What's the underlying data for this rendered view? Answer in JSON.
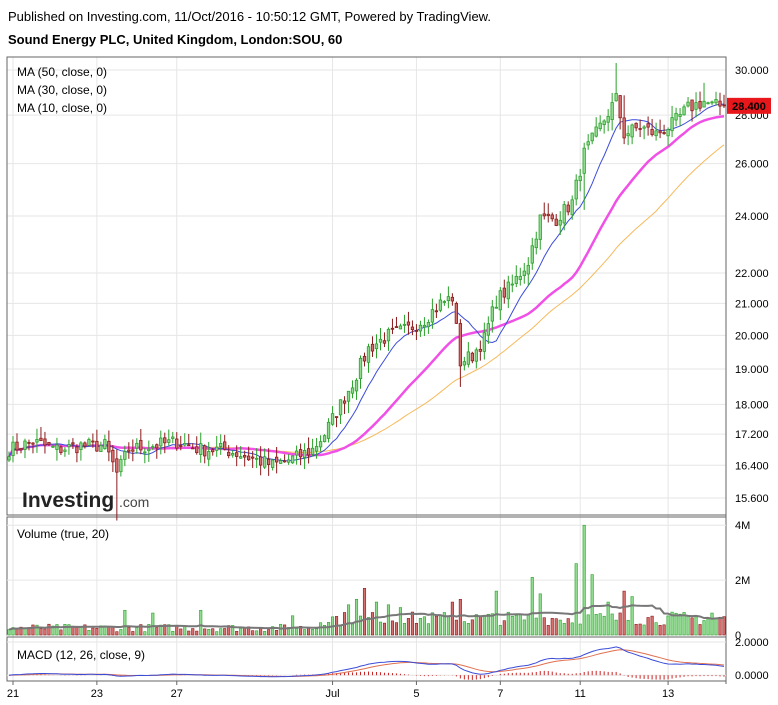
{
  "header": {
    "published": "Published on Investing.com, 11/Oct/2016 - 10:50:12 GMT, Powered by TradingView.",
    "instrument": "Sound Energy PLC, United Kingdom, London:SOU, 60"
  },
  "brand": {
    "logo_text": "Investing",
    "logo_suffix": ".com"
  },
  "colors": {
    "up": "#2aa22a",
    "up_fill": "#8fdc8f",
    "down": "#8b1a1a",
    "down_fill": "#d97070",
    "ma10": "#3b4cd8",
    "ma30": "#f050e6",
    "ma50": "#f6b95a",
    "vol_ma": "#777777",
    "macd": "#3b4cd8",
    "signal": "#e07050",
    "hist": "#cc2222",
    "price_tag": "#e8171b"
  },
  "chart_data": [
    {
      "type": "candlestick",
      "title": "Sound Energy PLC, United Kingdom, London:SOU, 60",
      "indicators": [
        "MA (50, close, 0)",
        "MA (30, close, 0)",
        "MA (10, close, 0)"
      ],
      "ylim": [
        15.2,
        30.6
      ],
      "y_scale": "log",
      "y_ticks": [
        "30.000",
        "28.000",
        "26.000",
        "24.000",
        "22.000",
        "21.000",
        "20.000",
        "19.000",
        "18.000",
        "17.200",
        "16.400",
        "15.600"
      ],
      "y_tick_values": [
        30,
        28,
        26,
        24,
        22,
        21,
        20,
        19,
        18,
        17.2,
        16.4,
        15.6
      ],
      "last_price": "28.400",
      "last_price_value": 28.4,
      "x_labels": [
        "21",
        "23",
        "27",
        "Jul",
        "5",
        "7",
        "11",
        "13"
      ],
      "x_label_bars": [
        1,
        22,
        42,
        81,
        102,
        123,
        143,
        165
      ],
      "anchors": [
        [
          0,
          16.8
        ],
        [
          6,
          17.0
        ],
        [
          12,
          16.8
        ],
        [
          18,
          16.9
        ],
        [
          24,
          16.9
        ],
        [
          27,
          16.2
        ],
        [
          30,
          16.8
        ],
        [
          36,
          16.9
        ],
        [
          42,
          17.0
        ],
        [
          48,
          16.8
        ],
        [
          54,
          16.8
        ],
        [
          60,
          16.6
        ],
        [
          66,
          16.4
        ],
        [
          72,
          16.6
        ],
        [
          76,
          16.8
        ],
        [
          79,
          17.2
        ],
        [
          82,
          17.8
        ],
        [
          86,
          18.6
        ],
        [
          90,
          19.6
        ],
        [
          95,
          20.0
        ],
        [
          100,
          20.2
        ],
        [
          104,
          20.5
        ],
        [
          108,
          21.0
        ],
        [
          111,
          21.2
        ],
        [
          113,
          19.2
        ],
        [
          116,
          19.4
        ],
        [
          119,
          19.9
        ],
        [
          122,
          21.1
        ],
        [
          126,
          21.6
        ],
        [
          130,
          22.4
        ],
        [
          133,
          23.9
        ],
        [
          137,
          23.9
        ],
        [
          141,
          24.5
        ],
        [
          144,
          26.4
        ],
        [
          148,
          27.5
        ],
        [
          152,
          28.7
        ],
        [
          154,
          27.2
        ],
        [
          158,
          27.5
        ],
        [
          162,
          27.2
        ],
        [
          166,
          27.6
        ],
        [
          170,
          28.3
        ],
        [
          174,
          28.6
        ],
        [
          176,
          28.4
        ]
      ],
      "series": [
        {
          "name": "MA (10, close, 0)",
          "period": 10
        },
        {
          "name": "MA (30, close, 0)",
          "period": 30
        },
        {
          "name": "MA (50, close, 0)",
          "period": 50
        }
      ]
    },
    {
      "type": "bar",
      "title": "Volume (true, 20)",
      "ylim": [
        0,
        4.3
      ],
      "unit": "M",
      "y_ticks": [
        "4M",
        "2M",
        "0"
      ],
      "y_tick_values": [
        4,
        2,
        0
      ],
      "spikes": [
        [
          29,
          0.9
        ],
        [
          36,
          0.8
        ],
        [
          48,
          0.9
        ],
        [
          71,
          0.7
        ],
        [
          85,
          1.1
        ],
        [
          87,
          1.3
        ],
        [
          89,
          1.7
        ],
        [
          92,
          1.2
        ],
        [
          95,
          1.1
        ],
        [
          98,
          1.0
        ],
        [
          111,
          1.2
        ],
        [
          113,
          1.3
        ],
        [
          122,
          1.6
        ],
        [
          131,
          2.1
        ],
        [
          133,
          1.5
        ],
        [
          142,
          2.6
        ],
        [
          144,
          4.0
        ],
        [
          146,
          2.2
        ],
        [
          150,
          1.2
        ],
        [
          154,
          1.6
        ],
        [
          156,
          1.4
        ],
        [
          176,
          0.8
        ]
      ],
      "series": [
        {
          "name": "Volume (true, 20)",
          "period": 20
        }
      ]
    },
    {
      "type": "line",
      "title": "MACD (12, 26, close, 9)",
      "ylim": [
        -0.35,
        2.3
      ],
      "y_ticks": [
        "2.0000",
        "0.0000"
      ],
      "y_tick_values": [
        2,
        0
      ],
      "params": {
        "fast": 12,
        "slow": 26,
        "signal": 9
      }
    }
  ]
}
